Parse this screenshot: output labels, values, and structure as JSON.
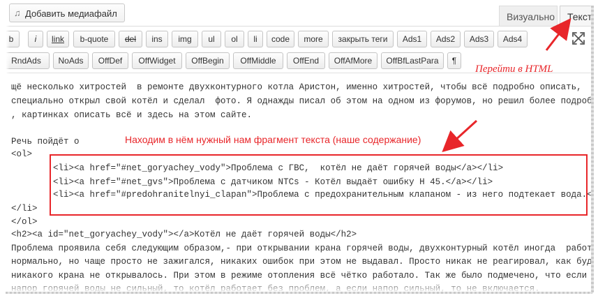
{
  "media_button": {
    "label": "Добавить медиафайл"
  },
  "tabs": {
    "visual": "Визуально",
    "text": "Текст"
  },
  "toolbar_row1": [
    "b",
    "i",
    "link",
    "b-quote",
    "del",
    "ins",
    "img",
    "ul",
    "ol",
    "li",
    "code",
    "more",
    "закрыть теги",
    "Ads1",
    "Ads2",
    "Ads3",
    "Ads4"
  ],
  "toolbar_row2": [
    "RndAds",
    "NoAds",
    "OffDef",
    "OffWidget",
    "OffBegin",
    "OffMiddle",
    "OffEnd",
    "OffAfMore",
    "OffBfLastPara",
    "¶"
  ],
  "annotations": {
    "go_html": "Перейти в HTML",
    "find_fragment": "Находим в нём нужный нам фрагмент текста (наше содержание)"
  },
  "code_lines": [
    "щё несколько хитростей  в ремонте двухконтурного котла Аристон, именно хитростей, чтобы всё подробно описать,",
    "специально открыл свой котёл и сделал  фото. Я однажды писал об этом на одном из форумов, но решил более подробно,",
    ", картинках описать всё и здесь на этом сайте.",
    "",
    "Речь пойдёт о",
    "<ol>",
    "        <li><a href=\"#net_goryachey_vody\">Проблема с ГВС,  котёл не даёт горячей воды</a></li>",
    "        <li><a href=\"#net_gvs\">Проблема с датчиком NTCs - Котёл выдаёт ошибку Н 45.</a></li>",
    "        <li><a href=\"#predohranitelnyi_clapan\">Проблема с предохранительным клапаном - из него подтекает вода.</a>",
    "</li>",
    "</ol>",
    "<h2><a id=\"net_goryachey_vody\"></a>Котёл не даёт горячей воды</h2>",
    "Проблема проявила себя следующим образом,- при открывании крана горячей воды, двухконтурный котёл иногда  работал",
    "нормально, но чаще просто не зажигался, никаких ошибок при этом не выдавал. Просто никак не реагировал, как будто",
    "никакого крана не открывалось. При этом в режиме отопления всё чётко работало. Так же было подмечено, что если",
    "напор горячей воды не сильный, то котёл работает без проблем, а если напор сильный, то не включается."
  ],
  "colors": {
    "annotation": "#e8262a",
    "toolbar_bg": "#f1f1f1",
    "text": "#333333"
  }
}
